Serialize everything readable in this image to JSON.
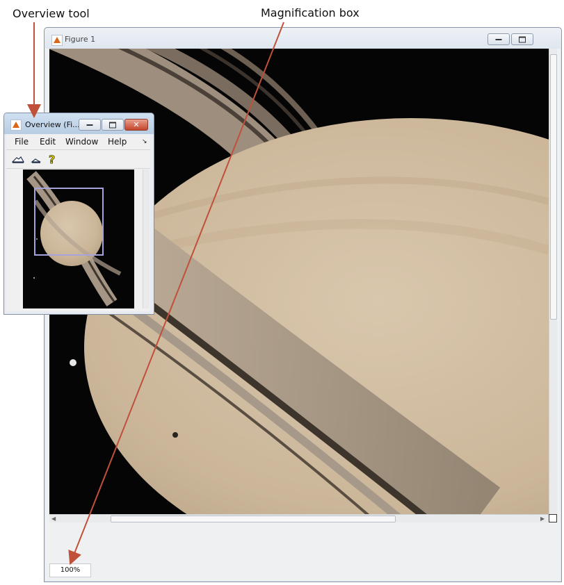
{
  "callouts": {
    "overview_tool": "Overview tool",
    "magnification_box": "Magnification box"
  },
  "figure_window": {
    "title": "Figure 1",
    "icon": "matlab-icon",
    "controls": [
      "minimize-icon",
      "maximize-icon"
    ],
    "status": {
      "magnification": "100%"
    }
  },
  "overview_window": {
    "title": "Overview (Fi...",
    "icon": "matlab-icon",
    "controls": [
      "minimize-icon",
      "maximize-icon",
      "close-icon"
    ],
    "menu": [
      "File",
      "Edit",
      "Window",
      "Help"
    ],
    "toolbar_icons": [
      "zoom-in-icon",
      "zoom-out-icon",
      "help-icon"
    ]
  },
  "colors": {
    "annotation_arrow": "#c0503a",
    "detail_rectangle": "#a7a4dc",
    "image_background": "#050505"
  }
}
